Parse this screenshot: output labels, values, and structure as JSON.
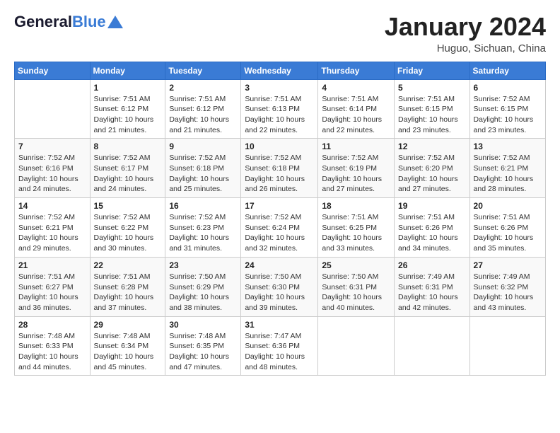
{
  "header": {
    "logo_general": "General",
    "logo_blue": "Blue",
    "month_title": "January 2024",
    "location": "Huguo, Sichuan, China"
  },
  "weekdays": [
    "Sunday",
    "Monday",
    "Tuesday",
    "Wednesday",
    "Thursday",
    "Friday",
    "Saturday"
  ],
  "weeks": [
    [
      {
        "day": "",
        "sunrise": "",
        "sunset": "",
        "daylight": ""
      },
      {
        "day": "1",
        "sunrise": "Sunrise: 7:51 AM",
        "sunset": "Sunset: 6:12 PM",
        "daylight": "Daylight: 10 hours and 21 minutes."
      },
      {
        "day": "2",
        "sunrise": "Sunrise: 7:51 AM",
        "sunset": "Sunset: 6:12 PM",
        "daylight": "Daylight: 10 hours and 21 minutes."
      },
      {
        "day": "3",
        "sunrise": "Sunrise: 7:51 AM",
        "sunset": "Sunset: 6:13 PM",
        "daylight": "Daylight: 10 hours and 22 minutes."
      },
      {
        "day": "4",
        "sunrise": "Sunrise: 7:51 AM",
        "sunset": "Sunset: 6:14 PM",
        "daylight": "Daylight: 10 hours and 22 minutes."
      },
      {
        "day": "5",
        "sunrise": "Sunrise: 7:51 AM",
        "sunset": "Sunset: 6:15 PM",
        "daylight": "Daylight: 10 hours and 23 minutes."
      },
      {
        "day": "6",
        "sunrise": "Sunrise: 7:52 AM",
        "sunset": "Sunset: 6:15 PM",
        "daylight": "Daylight: 10 hours and 23 minutes."
      }
    ],
    [
      {
        "day": "7",
        "sunrise": "Sunrise: 7:52 AM",
        "sunset": "Sunset: 6:16 PM",
        "daylight": "Daylight: 10 hours and 24 minutes."
      },
      {
        "day": "8",
        "sunrise": "Sunrise: 7:52 AM",
        "sunset": "Sunset: 6:17 PM",
        "daylight": "Daylight: 10 hours and 24 minutes."
      },
      {
        "day": "9",
        "sunrise": "Sunrise: 7:52 AM",
        "sunset": "Sunset: 6:18 PM",
        "daylight": "Daylight: 10 hours and 25 minutes."
      },
      {
        "day": "10",
        "sunrise": "Sunrise: 7:52 AM",
        "sunset": "Sunset: 6:18 PM",
        "daylight": "Daylight: 10 hours and 26 minutes."
      },
      {
        "day": "11",
        "sunrise": "Sunrise: 7:52 AM",
        "sunset": "Sunset: 6:19 PM",
        "daylight": "Daylight: 10 hours and 27 minutes."
      },
      {
        "day": "12",
        "sunrise": "Sunrise: 7:52 AM",
        "sunset": "Sunset: 6:20 PM",
        "daylight": "Daylight: 10 hours and 27 minutes."
      },
      {
        "day": "13",
        "sunrise": "Sunrise: 7:52 AM",
        "sunset": "Sunset: 6:21 PM",
        "daylight": "Daylight: 10 hours and 28 minutes."
      }
    ],
    [
      {
        "day": "14",
        "sunrise": "Sunrise: 7:52 AM",
        "sunset": "Sunset: 6:21 PM",
        "daylight": "Daylight: 10 hours and 29 minutes."
      },
      {
        "day": "15",
        "sunrise": "Sunrise: 7:52 AM",
        "sunset": "Sunset: 6:22 PM",
        "daylight": "Daylight: 10 hours and 30 minutes."
      },
      {
        "day": "16",
        "sunrise": "Sunrise: 7:52 AM",
        "sunset": "Sunset: 6:23 PM",
        "daylight": "Daylight: 10 hours and 31 minutes."
      },
      {
        "day": "17",
        "sunrise": "Sunrise: 7:52 AM",
        "sunset": "Sunset: 6:24 PM",
        "daylight": "Daylight: 10 hours and 32 minutes."
      },
      {
        "day": "18",
        "sunrise": "Sunrise: 7:51 AM",
        "sunset": "Sunset: 6:25 PM",
        "daylight": "Daylight: 10 hours and 33 minutes."
      },
      {
        "day": "19",
        "sunrise": "Sunrise: 7:51 AM",
        "sunset": "Sunset: 6:26 PM",
        "daylight": "Daylight: 10 hours and 34 minutes."
      },
      {
        "day": "20",
        "sunrise": "Sunrise: 7:51 AM",
        "sunset": "Sunset: 6:26 PM",
        "daylight": "Daylight: 10 hours and 35 minutes."
      }
    ],
    [
      {
        "day": "21",
        "sunrise": "Sunrise: 7:51 AM",
        "sunset": "Sunset: 6:27 PM",
        "daylight": "Daylight: 10 hours and 36 minutes."
      },
      {
        "day": "22",
        "sunrise": "Sunrise: 7:51 AM",
        "sunset": "Sunset: 6:28 PM",
        "daylight": "Daylight: 10 hours and 37 minutes."
      },
      {
        "day": "23",
        "sunrise": "Sunrise: 7:50 AM",
        "sunset": "Sunset: 6:29 PM",
        "daylight": "Daylight: 10 hours and 38 minutes."
      },
      {
        "day": "24",
        "sunrise": "Sunrise: 7:50 AM",
        "sunset": "Sunset: 6:30 PM",
        "daylight": "Daylight: 10 hours and 39 minutes."
      },
      {
        "day": "25",
        "sunrise": "Sunrise: 7:50 AM",
        "sunset": "Sunset: 6:31 PM",
        "daylight": "Daylight: 10 hours and 40 minutes."
      },
      {
        "day": "26",
        "sunrise": "Sunrise: 7:49 AM",
        "sunset": "Sunset: 6:31 PM",
        "daylight": "Daylight: 10 hours and 42 minutes."
      },
      {
        "day": "27",
        "sunrise": "Sunrise: 7:49 AM",
        "sunset": "Sunset: 6:32 PM",
        "daylight": "Daylight: 10 hours and 43 minutes."
      }
    ],
    [
      {
        "day": "28",
        "sunrise": "Sunrise: 7:48 AM",
        "sunset": "Sunset: 6:33 PM",
        "daylight": "Daylight: 10 hours and 44 minutes."
      },
      {
        "day": "29",
        "sunrise": "Sunrise: 7:48 AM",
        "sunset": "Sunset: 6:34 PM",
        "daylight": "Daylight: 10 hours and 45 minutes."
      },
      {
        "day": "30",
        "sunrise": "Sunrise: 7:48 AM",
        "sunset": "Sunset: 6:35 PM",
        "daylight": "Daylight: 10 hours and 47 minutes."
      },
      {
        "day": "31",
        "sunrise": "Sunrise: 7:47 AM",
        "sunset": "Sunset: 6:36 PM",
        "daylight": "Daylight: 10 hours and 48 minutes."
      },
      {
        "day": "",
        "sunrise": "",
        "sunset": "",
        "daylight": ""
      },
      {
        "day": "",
        "sunrise": "",
        "sunset": "",
        "daylight": ""
      },
      {
        "day": "",
        "sunrise": "",
        "sunset": "",
        "daylight": ""
      }
    ]
  ]
}
